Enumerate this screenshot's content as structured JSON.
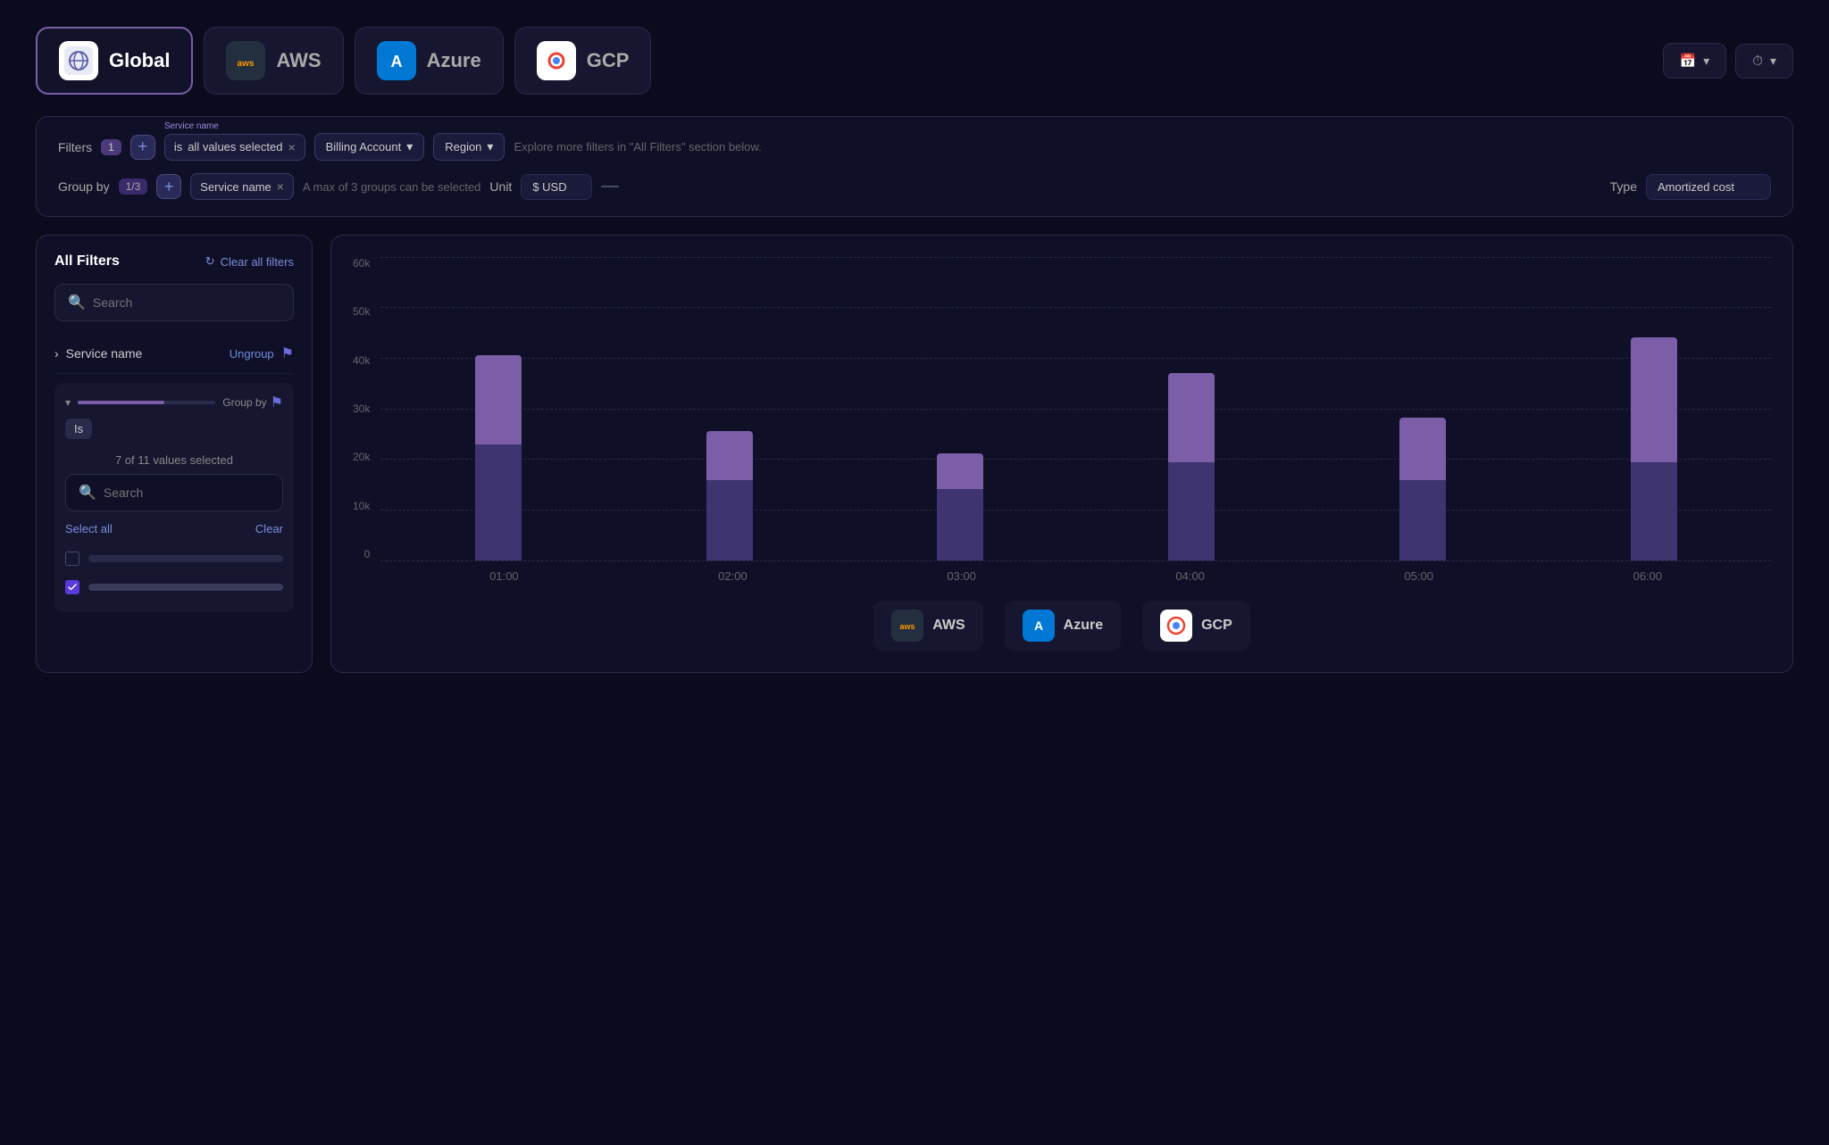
{
  "tabs": [
    {
      "id": "global",
      "label": "Global",
      "icon": "🌐",
      "iconType": "global",
      "active": true
    },
    {
      "id": "aws",
      "label": "AWS",
      "icon": "aws",
      "iconType": "aws",
      "active": false
    },
    {
      "id": "azure",
      "label": "Azure",
      "icon": "A",
      "iconType": "azure",
      "active": false
    },
    {
      "id": "gcp",
      "label": "GCP",
      "icon": "G",
      "iconType": "gcp",
      "active": false
    }
  ],
  "top_right": {
    "date_icon": "📅",
    "time_icon": "⏱"
  },
  "filters": {
    "label": "Filters",
    "badge": "1",
    "add_label": "+",
    "service_name_label": "Service name",
    "is_label": "is",
    "all_values_label": "all values selected",
    "billing_account_label": "Billing Account",
    "region_label": "Region",
    "hint": "Explore more filters in \"All Filters\" section below.",
    "group_by_label": "Group by",
    "group_badge": "1/3",
    "group_service_name": "Service name",
    "group_hint": "A max of 3 groups can be selected",
    "unit_label": "Unit",
    "unit_value": "$ USD",
    "separator": "—",
    "type_label": "Type",
    "type_value": "Amortized cost"
  },
  "left_panel": {
    "title": "All Filters",
    "clear_all": "Clear all filters",
    "search_placeholder": "Search",
    "service_name_label": "Service name",
    "ungroup_label": "Ungroup",
    "is_label": "Is",
    "selection_count": "7 of 11 values selected",
    "search2_placeholder": "Search",
    "select_all": "Select all",
    "clear_label": "Clear"
  },
  "chart": {
    "y_labels": [
      "60k",
      "50k",
      "40k",
      "30k",
      "20k",
      "10k",
      "0"
    ],
    "bars": [
      {
        "time": "01:00",
        "top_height": 100,
        "bottom_height": 130
      },
      {
        "time": "02:00",
        "top_height": 55,
        "bottom_height": 90
      },
      {
        "time": "03:00",
        "top_height": 40,
        "bottom_height": 80
      },
      {
        "time": "04:00",
        "top_height": 100,
        "bottom_height": 110
      },
      {
        "time": "05:00",
        "top_height": 70,
        "bottom_height": 90
      },
      {
        "time": "06:00",
        "top_height": 140,
        "bottom_height": 110
      }
    ],
    "legend": [
      {
        "id": "aws",
        "label": "AWS",
        "iconType": "aws-icon"
      },
      {
        "id": "azure",
        "label": "Azure",
        "iconType": "azure-icon"
      },
      {
        "id": "gcp",
        "label": "GCP",
        "iconType": "gcp-icon"
      }
    ]
  }
}
